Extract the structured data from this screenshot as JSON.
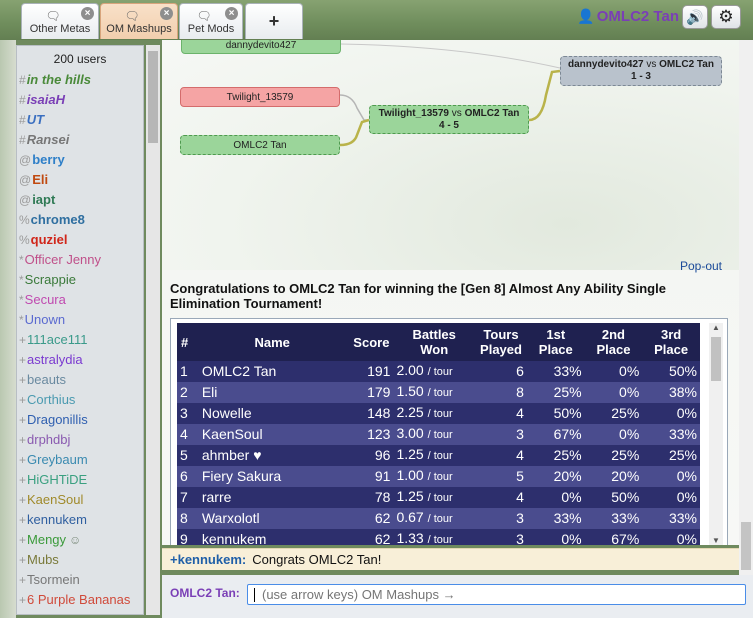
{
  "tabs": [
    {
      "label": "Other Metas",
      "icon": "chat-bubble-icon"
    },
    {
      "label": "OM Mashups",
      "icon": "chat-bubbles-icon"
    },
    {
      "label": "Pet Mods",
      "icon": "chat-bubble-icon"
    }
  ],
  "new_tab_label": "+",
  "current_user": "OMLC2 Tan",
  "userlist": {
    "count_text": "200 users",
    "users": [
      {
        "rank": "#",
        "name": "in the hills",
        "color": "#4a8a3a",
        "away": true
      },
      {
        "rank": "#",
        "name": "isaiaH",
        "color": "#7a3fb6",
        "away": true
      },
      {
        "rank": "#",
        "name": "UT",
        "color": "#3a6fc0",
        "away": true
      },
      {
        "rank": "#",
        "name": "Ransei",
        "color": "#777777",
        "away": true
      },
      {
        "rank": "@",
        "name": "berry",
        "color": "#2e7fc8",
        "away": false,
        "bold": true
      },
      {
        "rank": "@",
        "name": "Eli",
        "color": "#c04a10",
        "away": false,
        "bold": true
      },
      {
        "rank": "@",
        "name": "iapt",
        "color": "#2f7a55",
        "away": false,
        "bold": true
      },
      {
        "rank": "%",
        "name": "chrome8",
        "color": "#2f6fa0",
        "away": false,
        "bold": true
      },
      {
        "rank": "%",
        "name": "quziel",
        "color": "#d0261a",
        "away": false,
        "bold": true
      },
      {
        "rank": "*",
        "name": "Officer Jenny",
        "color": "#c0508a",
        "away": false
      },
      {
        "rank": "*",
        "name": "Scrappie",
        "color": "#3a7a3a",
        "away": false
      },
      {
        "rank": "*",
        "name": "Secura",
        "color": "#c04ab0",
        "away": false
      },
      {
        "rank": "*",
        "name": "Unown",
        "color": "#5a6ad0",
        "away": false
      },
      {
        "rank": "+",
        "name": "111ace111",
        "color": "#3a9a8a",
        "away": false
      },
      {
        "rank": "+",
        "name": "astralydia",
        "color": "#7a3ad0",
        "away": false
      },
      {
        "rank": "+",
        "name": "beauts",
        "color": "#6a8aa0",
        "away": false
      },
      {
        "rank": "+",
        "name": "Corthius",
        "color": "#4a9ab0",
        "away": false
      },
      {
        "rank": "+",
        "name": "Dragonillis",
        "color": "#2f5fb0",
        "away": false
      },
      {
        "rank": "+",
        "name": "drphdbj",
        "color": "#8a5ab0",
        "away": false
      },
      {
        "rank": "+",
        "name": "Greybaum",
        "color": "#3a8ab0",
        "away": false
      },
      {
        "rank": "+",
        "name": "HiGHTiDE",
        "color": "#3aa080",
        "away": false
      },
      {
        "rank": "+",
        "name": "KaenSoul",
        "color": "#a08a2a",
        "away": false
      },
      {
        "rank": "+",
        "name": "kennukem",
        "color": "#2f5fa0",
        "away": false
      },
      {
        "rank": "+",
        "name": "Mengy",
        "color": "#3a9a3a",
        "away": false,
        "status": "☺"
      },
      {
        "rank": "+",
        "name": "Mubs",
        "color": "#7a7a3a",
        "away": false
      },
      {
        "rank": "+",
        "name": "Tsormein",
        "color": "#777777",
        "away": false
      },
      {
        "rank": "+",
        "name": "6 Purple Bananas",
        "color": "#d04a3a",
        "away": false
      }
    ]
  },
  "bracket": {
    "node_top": "dannydevito427",
    "node_twilight": "Twilight_13579",
    "node_omlc": "OMLC2 Tan",
    "match1": {
      "p1": "Twilight_13579",
      "vs": "vs",
      "p2": "OMLC2 Tan",
      "score": "4 - 5"
    },
    "match2": {
      "p1": "dannydevito427",
      "vs": "vs",
      "p2": "OMLC2 Tan",
      "score": "1 - 3"
    },
    "popout": "Pop-out"
  },
  "congrats_text": "Congratulations to OMLC2 Tan for winning the [Gen 8] Almost Any Ability Single Elimination Tournament!",
  "table": {
    "headers": [
      "#",
      "Name",
      "Score",
      "Battles Won",
      "Tours Played",
      "1st Place",
      "2nd Place",
      "3rd Place"
    ],
    "rows": [
      {
        "n": "1",
        "name": "OMLC2 Tan",
        "score": "191",
        "bw": "2.00",
        "unit": "/ tour",
        "tp": "6",
        "p1": "33%",
        "p2": "0%",
        "p3": "50%"
      },
      {
        "n": "2",
        "name": "Eli",
        "score": "179",
        "bw": "1.50",
        "unit": "/ tour",
        "tp": "8",
        "p1": "25%",
        "p2": "0%",
        "p3": "38%"
      },
      {
        "n": "3",
        "name": "Nowelle",
        "score": "148",
        "bw": "2.25",
        "unit": "/ tour",
        "tp": "4",
        "p1": "50%",
        "p2": "25%",
        "p3": "0%"
      },
      {
        "n": "4",
        "name": "KaenSoul",
        "score": "123",
        "bw": "3.00",
        "unit": "/ tour",
        "tp": "3",
        "p1": "67%",
        "p2": "0%",
        "p3": "33%"
      },
      {
        "n": "5",
        "name": "ahmber ♥",
        "score": "96",
        "bw": "1.25",
        "unit": "/ tour",
        "tp": "4",
        "p1": "25%",
        "p2": "25%",
        "p3": "25%"
      },
      {
        "n": "6",
        "name": "Fiery Sakura",
        "score": "91",
        "bw": "1.00",
        "unit": "/ tour",
        "tp": "5",
        "p1": "20%",
        "p2": "20%",
        "p3": "0%"
      },
      {
        "n": "7",
        "name": "rarre",
        "score": "78",
        "bw": "1.25",
        "unit": "/ tour",
        "tp": "4",
        "p1": "0%",
        "p2": "50%",
        "p3": "0%"
      },
      {
        "n": "8",
        "name": "Warxolotl",
        "score": "62",
        "bw": "0.67",
        "unit": "/ tour",
        "tp": "3",
        "p1": "33%",
        "p2": "33%",
        "p3": "33%"
      },
      {
        "n": "9",
        "name": "kennukem",
        "score": "62",
        "bw": "1.33",
        "unit": "/ tour",
        "tp": "3",
        "p1": "0%",
        "p2": "67%",
        "p3": "0%"
      }
    ]
  },
  "chat": {
    "user": "+kennukem:",
    "message": "Congrats OMLC2 Tan!"
  },
  "input": {
    "label": "OMLC2 Tan:",
    "placeholder": "(use arrow keys) OM Mashups →"
  }
}
